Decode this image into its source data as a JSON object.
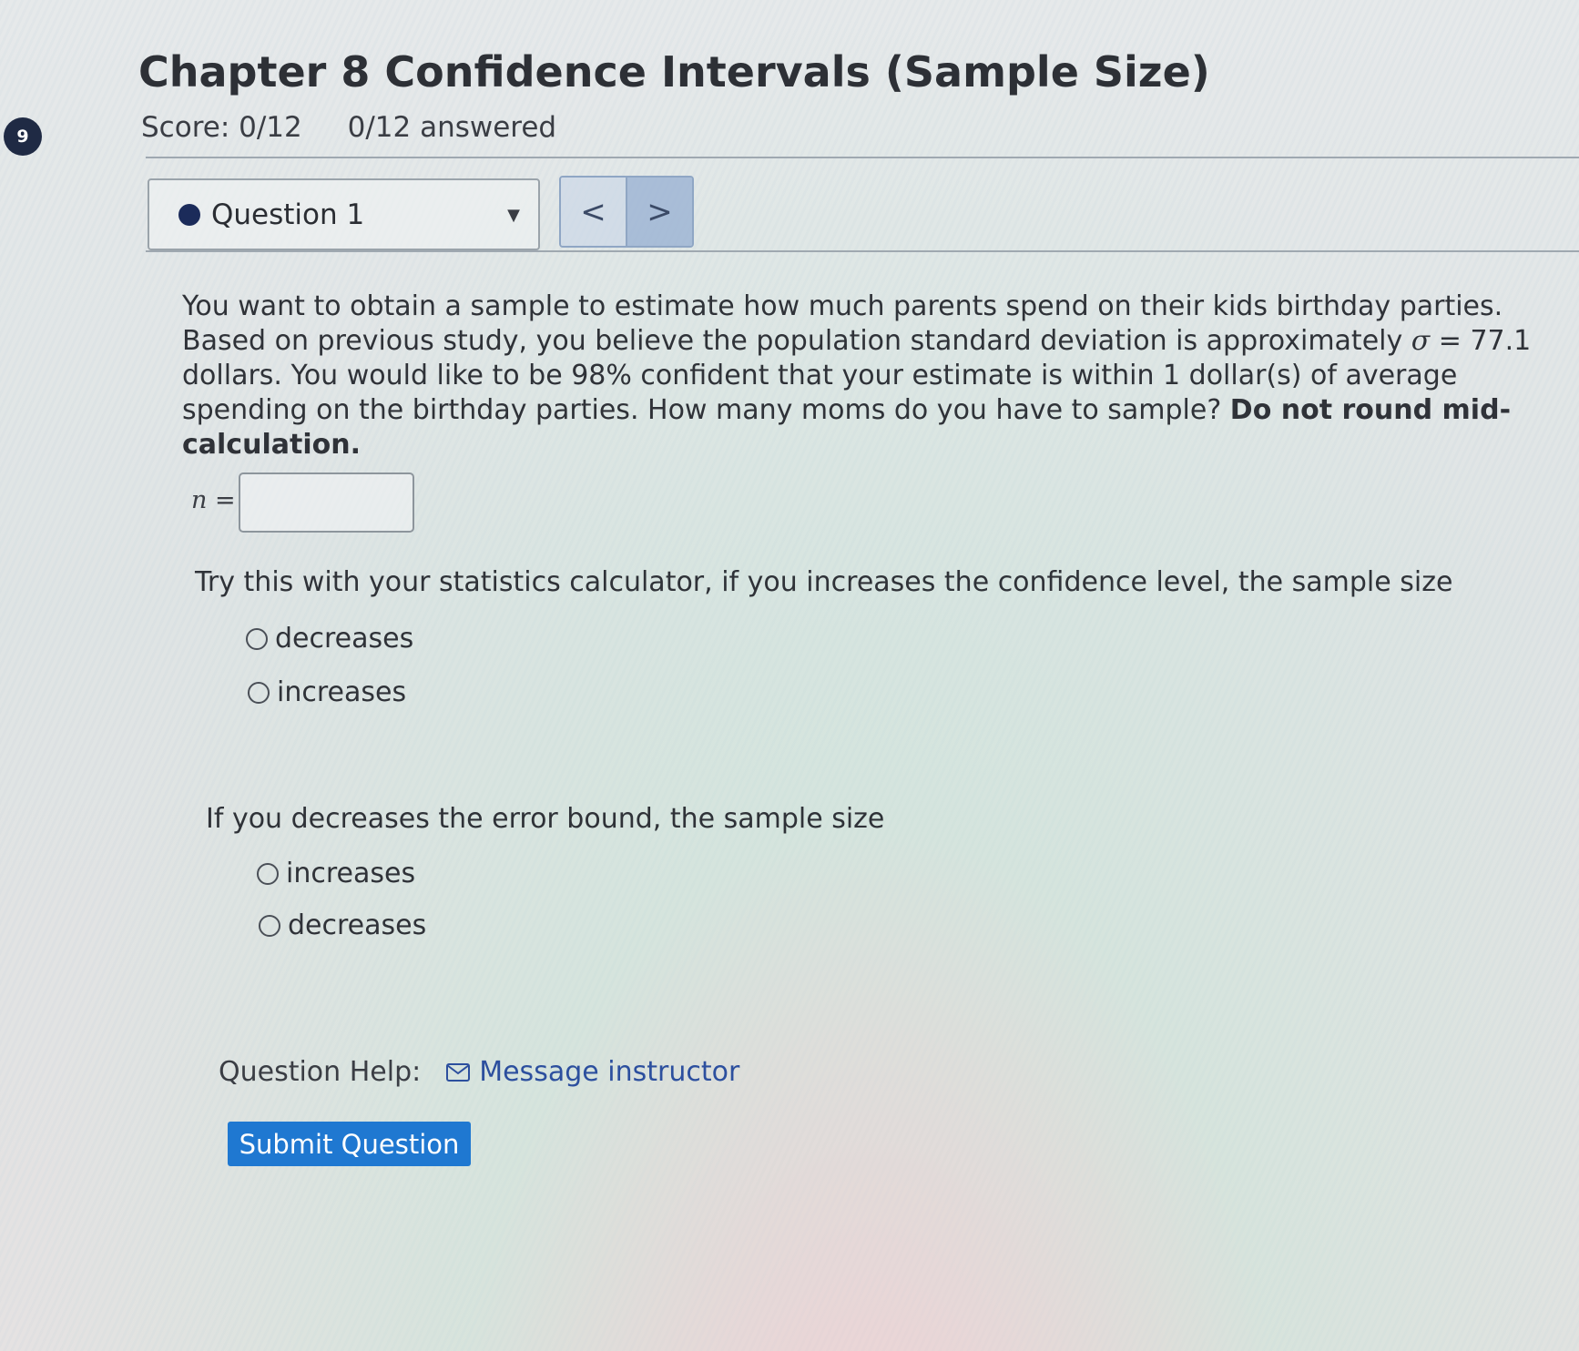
{
  "sidebar": {
    "badge_number": "9"
  },
  "header": {
    "title": "Chapter 8 Confidence Intervals (Sample Size)",
    "score": "Score: 0/12",
    "answered": "0/12 answered"
  },
  "navigation": {
    "question_select_value": "Question 1",
    "prev_label": "<",
    "next_label": ">"
  },
  "question": {
    "prompt_part1": "You want to obtain a sample to estimate how much parents spend on their kids birthday parties. Based on previous study, you believe the population standard deviation is approximately ",
    "sigma_symbol": "σ",
    "sigma_equals": " = 77.1",
    "prompt_part2": " dollars. You would like to be 98% confident that your estimate is within 1 dollar(s) of average spending on the birthday parties. How many moms do you have to sample? ",
    "prompt_emphasis": "Do not round mid-calculation.",
    "n_label_var": "n",
    "n_label_eq": " =",
    "n_value": ""
  },
  "part2": {
    "text": "Try this with your statistics calculator, if you increases the confidence level, the sample size",
    "options": [
      "decreases",
      "increases"
    ]
  },
  "part3": {
    "text": "If you decreases the error bound, the sample size",
    "options": [
      "increases",
      "decreases"
    ]
  },
  "help": {
    "label": "Question Help:",
    "message_link": "Message instructor",
    "icon": "mail-icon"
  },
  "actions": {
    "submit_label": "Submit Question"
  },
  "colors": {
    "accent": "#1f78d1",
    "link": "#2c4f9e",
    "badge": "#1f2a44"
  }
}
